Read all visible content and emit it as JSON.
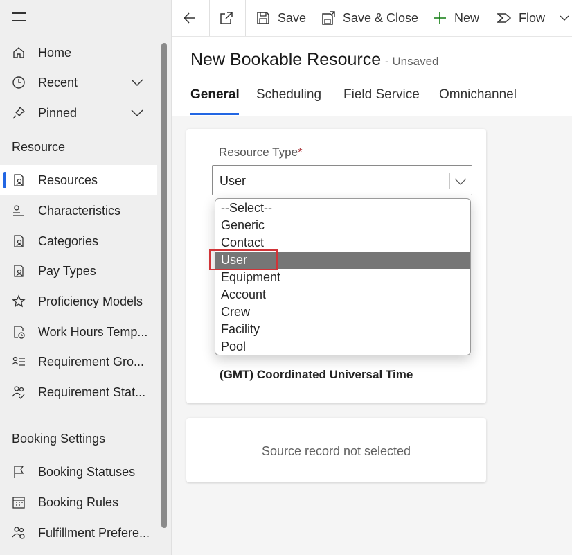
{
  "sidebar": {
    "home": "Home",
    "recent": "Recent",
    "pinned": "Pinned",
    "section_resource": "Resource",
    "items": [
      {
        "label": "Resources"
      },
      {
        "label": "Characteristics"
      },
      {
        "label": "Categories"
      },
      {
        "label": "Pay Types"
      },
      {
        "label": "Proficiency Models"
      },
      {
        "label": "Work Hours Temp..."
      },
      {
        "label": "Requirement Gro..."
      },
      {
        "label": "Requirement Stat..."
      }
    ],
    "section_booking": "Booking Settings",
    "booking_items": [
      {
        "label": "Booking Statuses"
      },
      {
        "label": "Booking Rules"
      },
      {
        "label": "Fulfillment Prefere..."
      }
    ]
  },
  "toolbar": {
    "save": "Save",
    "save_close": "Save & Close",
    "new": "New",
    "flow": "Flow"
  },
  "header": {
    "title": "New Bookable Resource",
    "status": "- Unsaved",
    "tabs": [
      "General",
      "Scheduling",
      "Field Service",
      "Omnichannel"
    ]
  },
  "form": {
    "resource_type_label": "Resource Type",
    "required_mark": "*",
    "resource_type_value": "User",
    "options": [
      "--Select--",
      "Generic",
      "Contact",
      "User",
      "Equipment",
      "Account",
      "Crew",
      "Facility",
      "Pool"
    ],
    "timezone": "(GMT) Coordinated Universal Time",
    "source_record": "Source record not selected"
  },
  "colors": {
    "accent": "#2266e3",
    "highlight": "#767676",
    "annotation": "#d13438",
    "add_icon": "#107c10"
  }
}
